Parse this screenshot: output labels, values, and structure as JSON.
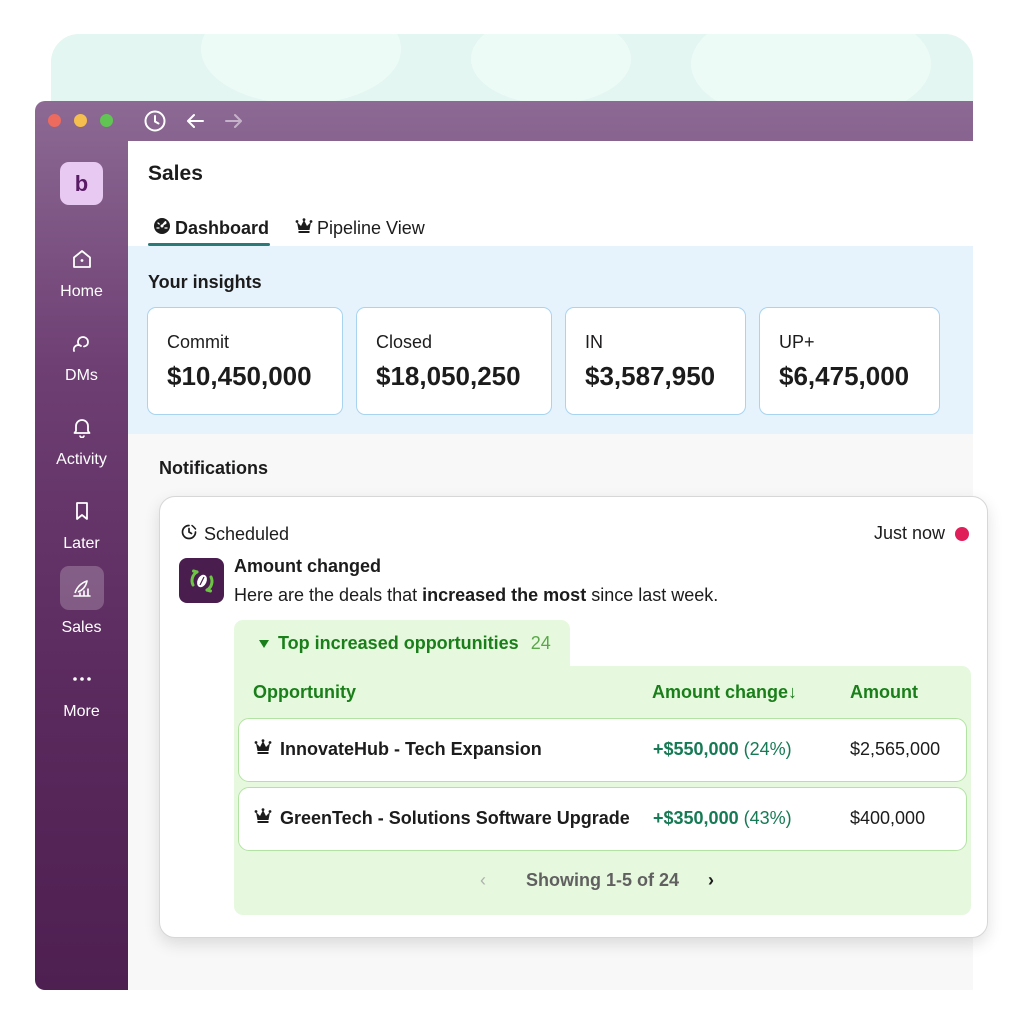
{
  "window": {
    "controls": [
      "close",
      "minimize",
      "maximize"
    ],
    "toolbar_icons": [
      "history-icon",
      "back-arrow-icon",
      "forward-arrow-icon"
    ]
  },
  "sidebar": {
    "workspace_letter": "b",
    "items": [
      {
        "label": "Home",
        "icon": "home-icon"
      },
      {
        "label": "DMs",
        "icon": "dms-icon"
      },
      {
        "label": "Activity",
        "icon": "bell-icon"
      },
      {
        "label": "Later",
        "icon": "bookmark-icon"
      },
      {
        "label": "Sales",
        "icon": "sales-icon",
        "active": true
      },
      {
        "label": "More",
        "icon": "more-icon"
      }
    ]
  },
  "header": {
    "title": "Sales",
    "tabs": [
      {
        "label": "Dashboard",
        "icon": "gauge-icon",
        "active": true
      },
      {
        "label": "Pipeline View",
        "icon": "crown-icon",
        "active": false
      }
    ]
  },
  "insights": {
    "title": "Your insights",
    "cards": [
      {
        "label": "Commit",
        "value": "$10,450,000"
      },
      {
        "label": "Closed",
        "value": "$18,050,250"
      },
      {
        "label": "IN",
        "value": "$3,587,950"
      },
      {
        "label": "UP+",
        "value": "$6,475,000"
      }
    ]
  },
  "notifications": {
    "title": "Notifications",
    "card": {
      "scheduled_label": "Scheduled",
      "time": "Just now",
      "message_title": "Amount changed",
      "message_pre": "Here are the deals that ",
      "message_bold": "increased the most",
      "message_post": " since last week.",
      "section_title": "Top increased opportunities",
      "section_count": "24",
      "columns": [
        "Opportunity",
        "Amount change↓",
        "Amount"
      ],
      "rows": [
        {
          "name": "InnovateHub - Tech Expansion",
          "change": "+$550,000",
          "pct": "(24%)",
          "amount": "$2,565,000"
        },
        {
          "name": "GreenTech - Solutions Software Upgrade",
          "change": "+$350,000",
          "pct": "(43%)",
          "amount": "$400,000"
        }
      ],
      "pager": {
        "prev": "‹",
        "text": "Showing 1-5 of 24",
        "next": "›"
      }
    }
  },
  "colors": {
    "sidebar_top": "#8c6a94",
    "sidebar_bottom": "#4e1f51",
    "accent_green": "#1a7f1a",
    "positive_change": "#167a54",
    "unread_dot": "#e01e5a",
    "insight_border": "#a9d4ef"
  }
}
